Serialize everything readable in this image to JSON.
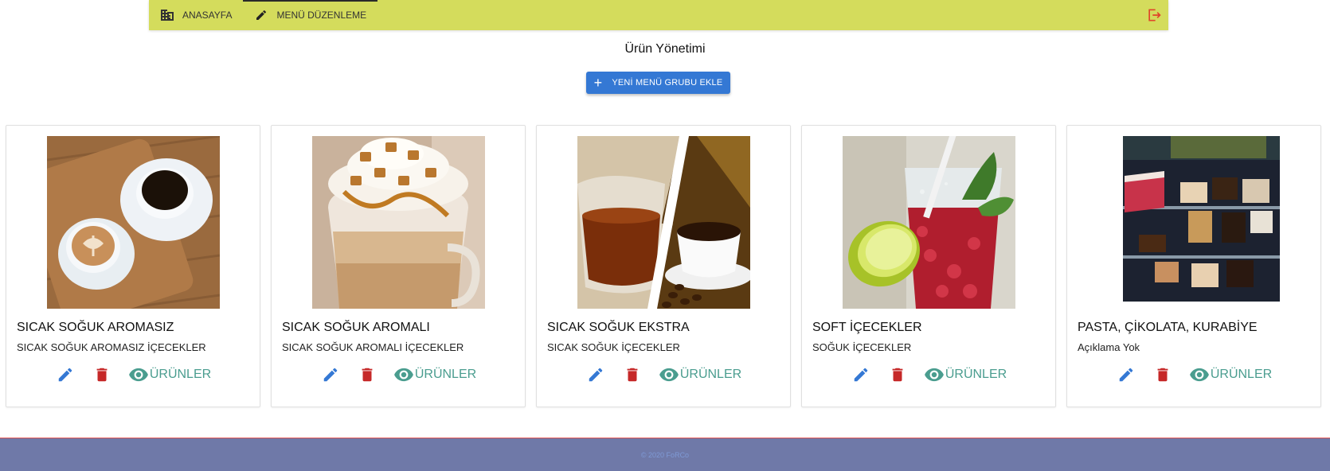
{
  "nav": {
    "tabs": [
      {
        "label": "ANASAYFA",
        "icon": "building-icon"
      },
      {
        "label": "MENÜ DÜZENLEME",
        "icon": "pencil-icon"
      }
    ],
    "logout_icon": "logout-icon",
    "bar_color": "#d4dc5c"
  },
  "page": {
    "title": "Ürün Yönetimi",
    "add_button_label": "YENİ MENÜ GRUBU EKLE"
  },
  "colors": {
    "primary": "#3478d4",
    "danger": "#c62828",
    "teal": "#4a9d8f",
    "footer": "#6f79a8"
  },
  "cards": [
    {
      "title": "SICAK SOĞUK AROMASIZ",
      "description": "SICAK SOĞUK AROMASIZ İÇECEKLER",
      "image": "coffee-cups-on-tray",
      "products_label": "ÜRÜNLER"
    },
    {
      "title": "SICAK SOĞUK AROMALI",
      "description": "SICAK SOĞUK AROMALI İÇECEKLER",
      "image": "caramel-latte-glass",
      "products_label": "ÜRÜNLER"
    },
    {
      "title": "SICAK SOĞUK EKSTRA",
      "description": "SICAK SOĞUK İÇECEKLER",
      "image": "tea-and-coffee-split",
      "products_label": "ÜRÜNLER"
    },
    {
      "title": "SOFT İÇECEKLER",
      "description": "SOĞUK İÇECEKLER",
      "image": "red-drink-with-lime",
      "products_label": "ÜRÜNLER"
    },
    {
      "title": "PASTA, ÇİKOLATA, KURABİYE",
      "description": "Açıklama Yok",
      "image": "cake-display-case",
      "products_label": "ÜRÜNLER"
    }
  ],
  "footer": {
    "text": "© 2020 FoRCo"
  }
}
